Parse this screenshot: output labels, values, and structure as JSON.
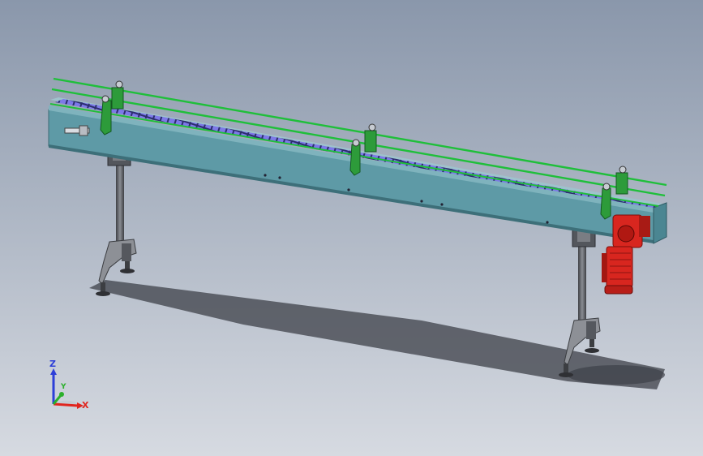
{
  "viewport": {
    "background_top": "#8a97ab",
    "background_bottom": "#d6dae1"
  },
  "model": {
    "frame_color": "#5e9aa6",
    "chain_color": "#7d79e8",
    "guide_rail_color": "#1fbf3a",
    "motor_color": "#d8261f",
    "leg_color": "#6c6f75"
  },
  "triad": {
    "x_label": "X",
    "y_label": "Y",
    "z_label": "Z",
    "x_color": "#e0251e",
    "y_color": "#2bb02b",
    "z_color": "#2d3fd8"
  }
}
